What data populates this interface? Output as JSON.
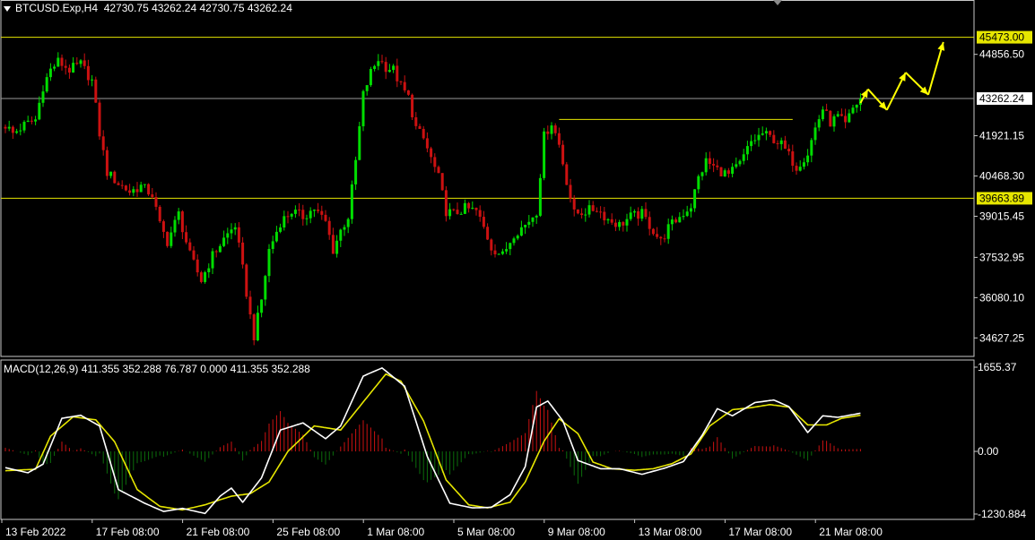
{
  "header": {
    "symbol": "BTCUSD.Exp,H4",
    "ohlc": "42730.75 43262.24 42730.75 43262.24"
  },
  "macd_header": {
    "label": "MACD(12,26,9)",
    "values": "411.355 352.288 76.787 0.000 411.355 352.288"
  },
  "colors": {
    "background": "#000000",
    "bull": "#00dd00",
    "bear": "#cc1111",
    "level_line": "#e6e600",
    "arrow": "#ffff00",
    "macd_line": "#ffffff",
    "signal_line": "#e6e600",
    "hist_pos": "#cc1111",
    "hist_neg": "#0b6e0b"
  },
  "chart_data": [
    {
      "type": "candlestick",
      "yaxis_ticks": [
        44856.5,
        41921.15,
        40468.3,
        39015.45,
        37532.95,
        36080.1,
        34627.25
      ],
      "ylim": [
        33960,
        46300
      ],
      "price_labels": [
        {
          "value": 45473.0,
          "text": "45473.00",
          "style": "level"
        },
        {
          "value": 43262.24,
          "text": "43262.24",
          "style": "current"
        },
        {
          "value": 39663.89,
          "text": "39663.89",
          "style": "level"
        }
      ],
      "levels": [
        45473.0,
        39663.89
      ],
      "current_price": 43262.24,
      "resistance_segment": {
        "value": 42510,
        "from_bar": 147,
        "to_bar": 209
      },
      "x_labels": [
        {
          "text": "13 Feb 2022",
          "bar": 0
        },
        {
          "text": "17 Feb 08:00",
          "bar": 24
        },
        {
          "text": "21 Feb 08:00",
          "bar": 48
        },
        {
          "text": "25 Feb 08:00",
          "bar": 72
        },
        {
          "text": "1 Mar 08:00",
          "bar": 96
        },
        {
          "text": "5 Mar 08:00",
          "bar": 120
        },
        {
          "text": "9 Mar 08:00",
          "bar": 144
        },
        {
          "text": "13 Mar 08:00",
          "bar": 168
        },
        {
          "text": "17 Mar 08:00",
          "bar": 192
        },
        {
          "text": "21 Mar 08:00",
          "bar": 216
        }
      ],
      "close_path": [
        [
          0,
          42300
        ],
        [
          2,
          42000
        ],
        [
          5,
          42300
        ],
        [
          8,
          42500
        ],
        [
          10,
          43700
        ],
        [
          12,
          44300
        ],
        [
          14,
          44600
        ],
        [
          17,
          44300
        ],
        [
          20,
          44500
        ],
        [
          23,
          43900
        ],
        [
          25,
          42000
        ],
        [
          27,
          40600
        ],
        [
          30,
          40200
        ],
        [
          33,
          39900
        ],
        [
          36,
          40100
        ],
        [
          39,
          39800
        ],
        [
          41,
          38700
        ],
        [
          43,
          38100
        ],
        [
          46,
          39100
        ],
        [
          49,
          37600
        ],
        [
          52,
          36700
        ],
        [
          55,
          37600
        ],
        [
          58,
          38200
        ],
        [
          61,
          38700
        ],
        [
          63,
          37100
        ],
        [
          65,
          35400
        ],
        [
          66,
          34700
        ],
        [
          68,
          36000
        ],
        [
          70,
          37800
        ],
        [
          73,
          38800
        ],
        [
          76,
          39200
        ],
        [
          79,
          39000
        ],
        [
          82,
          39300
        ],
        [
          85,
          38800
        ],
        [
          87,
          37800
        ],
        [
          89,
          38500
        ],
        [
          91,
          39000
        ],
        [
          93,
          41000
        ],
        [
          95,
          43400
        ],
        [
          97,
          44200
        ],
        [
          99,
          44700
        ],
        [
          101,
          44400
        ],
        [
          103,
          44300
        ],
        [
          105,
          43700
        ],
        [
          107,
          43300
        ],
        [
          109,
          42200
        ],
        [
          111,
          41800
        ],
        [
          113,
          41100
        ],
        [
          115,
          40400
        ],
        [
          117,
          39200
        ],
        [
          119,
          39100
        ],
        [
          122,
          39300
        ],
        [
          125,
          39200
        ],
        [
          127,
          38600
        ],
        [
          129,
          37900
        ],
        [
          132,
          37600
        ],
        [
          135,
          38400
        ],
        [
          138,
          38700
        ],
        [
          141,
          39200
        ],
        [
          143,
          41900
        ],
        [
          145,
          42400
        ],
        [
          147,
          41600
        ],
        [
          149,
          40300
        ],
        [
          151,
          39100
        ],
        [
          154,
          39200
        ],
        [
          157,
          39300
        ],
        [
          160,
          38900
        ],
        [
          163,
          38700
        ],
        [
          166,
          39000
        ],
        [
          169,
          39100
        ],
        [
          172,
          38500
        ],
        [
          174,
          38100
        ],
        [
          176,
          38600
        ],
        [
          179,
          39000
        ],
        [
          182,
          39400
        ],
        [
          184,
          40400
        ],
        [
          186,
          41000
        ],
        [
          189,
          40700
        ],
        [
          192,
          40500
        ],
        [
          195,
          40900
        ],
        [
          198,
          41700
        ],
        [
          201,
          42000
        ],
        [
          204,
          41800
        ],
        [
          206,
          41600
        ],
        [
          208,
          41200
        ],
        [
          210,
          40800
        ],
        [
          213,
          41300
        ],
        [
          215,
          42200
        ],
        [
          217,
          42900
        ],
        [
          219,
          42400
        ],
        [
          221,
          42600
        ],
        [
          223,
          42300
        ],
        [
          225,
          42900
        ],
        [
          227,
          43262.24
        ]
      ],
      "forecast_arrows": [
        {
          "from": [
            227,
            43100
          ],
          "to": [
            229,
            43600
          ]
        },
        {
          "from": [
            229,
            43600
          ],
          "to": [
            234,
            42850
          ]
        },
        {
          "from": [
            234,
            42850
          ],
          "to": [
            239,
            44200
          ]
        },
        {
          "from": [
            239,
            44200
          ],
          "to": [
            245,
            43400
          ]
        },
        {
          "from": [
            245,
            43400
          ],
          "to": [
            249,
            45300
          ]
        }
      ]
    },
    {
      "type": "macd",
      "yaxis_ticks": [
        1655.37,
        0.0,
        -1230.884
      ],
      "ylim": [
        -1230.884,
        1655.37
      ],
      "macd_path": [
        [
          0,
          -320
        ],
        [
          6,
          -420
        ],
        [
          10,
          -250
        ],
        [
          15,
          650
        ],
        [
          20,
          710
        ],
        [
          25,
          500
        ],
        [
          30,
          -750
        ],
        [
          37,
          -1020
        ],
        [
          42,
          -1180
        ],
        [
          47,
          -1120
        ],
        [
          53,
          -1220
        ],
        [
          57,
          -880
        ],
        [
          60,
          -720
        ],
        [
          63,
          -1000
        ],
        [
          68,
          -520
        ],
        [
          73,
          420
        ],
        [
          79,
          560
        ],
        [
          85,
          250
        ],
        [
          89,
          500
        ],
        [
          95,
          1480
        ],
        [
          100,
          1640
        ],
        [
          106,
          1280
        ],
        [
          112,
          -100
        ],
        [
          118,
          -1020
        ],
        [
          124,
          -1110
        ],
        [
          129,
          -1100
        ],
        [
          134,
          -850
        ],
        [
          138,
          -300
        ],
        [
          141,
          870
        ],
        [
          144,
          990
        ],
        [
          148,
          600
        ],
        [
          152,
          -180
        ],
        [
          158,
          -340
        ],
        [
          163,
          -340
        ],
        [
          169,
          -450
        ],
        [
          175,
          -330
        ],
        [
          180,
          -200
        ],
        [
          185,
          320
        ],
        [
          189,
          840
        ],
        [
          193,
          700
        ],
        [
          199,
          960
        ],
        [
          204,
          1010
        ],
        [
          208,
          880
        ],
        [
          213,
          370
        ],
        [
          217,
          700
        ],
        [
          221,
          670
        ],
        [
          227,
          750
        ]
      ],
      "signal_path": [
        [
          0,
          -380
        ],
        [
          8,
          -350
        ],
        [
          12,
          300
        ],
        [
          18,
          680
        ],
        [
          24,
          620
        ],
        [
          29,
          190
        ],
        [
          35,
          -750
        ],
        [
          41,
          -1080
        ],
        [
          47,
          -1150
        ],
        [
          53,
          -1050
        ],
        [
          57,
          -950
        ],
        [
          60,
          -880
        ],
        [
          65,
          -830
        ],
        [
          70,
          -600
        ],
        [
          75,
          0
        ],
        [
          82,
          500
        ],
        [
          89,
          420
        ],
        [
          95,
          970
        ],
        [
          101,
          1520
        ],
        [
          105,
          1380
        ],
        [
          111,
          600
        ],
        [
          117,
          -560
        ],
        [
          123,
          -1050
        ],
        [
          128,
          -1110
        ],
        [
          134,
          -1000
        ],
        [
          138,
          -600
        ],
        [
          143,
          200
        ],
        [
          147,
          640
        ],
        [
          152,
          350
        ],
        [
          156,
          -210
        ],
        [
          161,
          -340
        ],
        [
          167,
          -370
        ],
        [
          172,
          -340
        ],
        [
          177,
          -240
        ],
        [
          182,
          -50
        ],
        [
          187,
          500
        ],
        [
          193,
          820
        ],
        [
          198,
          860
        ],
        [
          203,
          920
        ],
        [
          208,
          870
        ],
        [
          213,
          520
        ],
        [
          218,
          520
        ],
        [
          222,
          650
        ],
        [
          227,
          710
        ]
      ]
    }
  ]
}
